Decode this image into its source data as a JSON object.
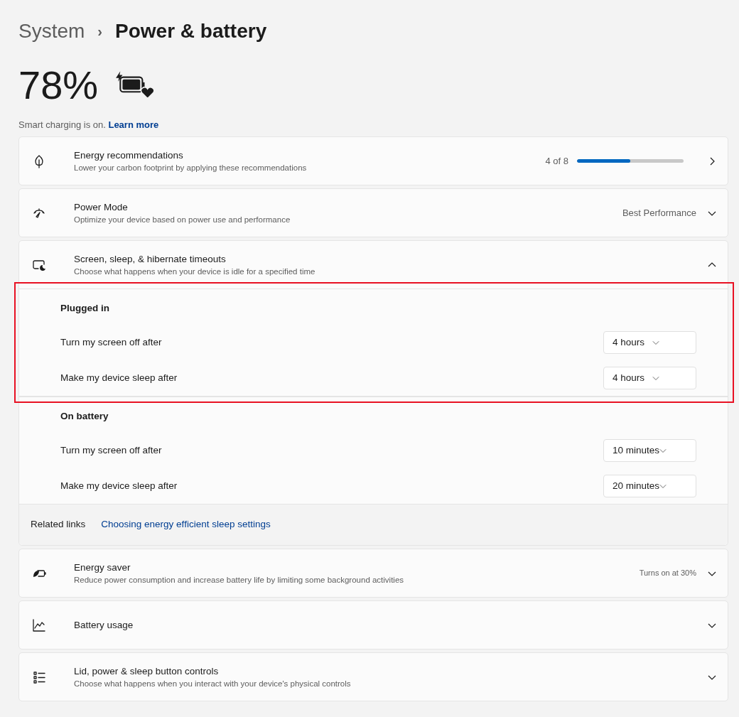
{
  "breadcrumb": {
    "parent": "System",
    "separator": "›",
    "current": "Power & battery"
  },
  "battery": {
    "percent": "78%",
    "note": "Smart charging is on.",
    "link": "Learn more"
  },
  "settings": [
    {
      "kind": "progress",
      "title": "Energy recommendations",
      "subtitle": "Lower your carbon footprint by applying these recommendations",
      "reading": "4 of 8",
      "level": 0.5
    },
    {
      "kind": "expander",
      "title": "Power Mode",
      "subtitle": "Optimize your device based on power use and performance",
      "value": "Best Performance",
      "expanded": false
    },
    {
      "kind": "expander",
      "title": "Screen, sleep, & hibernate timeouts",
      "subtitle": "Choose what happens when your device is idle for a specified time",
      "expanded": true,
      "groups": [
        {
          "heading": "Plugged in",
          "highlighted": true,
          "rows": [
            {
              "label": "Turn my screen off after",
              "value": "4 hours"
            },
            {
              "label": "Make my device sleep after",
              "value": "4 hours"
            }
          ]
        },
        {
          "heading": "On battery",
          "highlighted": false,
          "rows": [
            {
              "label": "Turn my screen off after",
              "value": "10 minutes"
            },
            {
              "label": "Make my device sleep after",
              "value": "20 minutes"
            }
          ]
        }
      ],
      "related": {
        "label": "Related links",
        "link": "Choosing energy efficient sleep settings"
      }
    },
    {
      "kind": "expander",
      "title": "Energy saver",
      "subtitle": "Reduce power consumption and increase battery life by limiting some background activities",
      "note": "Turns on at 30%",
      "expanded": false
    },
    {
      "kind": "expander",
      "title": "Battery usage",
      "expanded": false
    },
    {
      "kind": "expander",
      "title": "Lid, power & sleep button controls",
      "subtitle": "Choose what happens when you interact with your device's physical controls",
      "expanded": false
    }
  ]
}
